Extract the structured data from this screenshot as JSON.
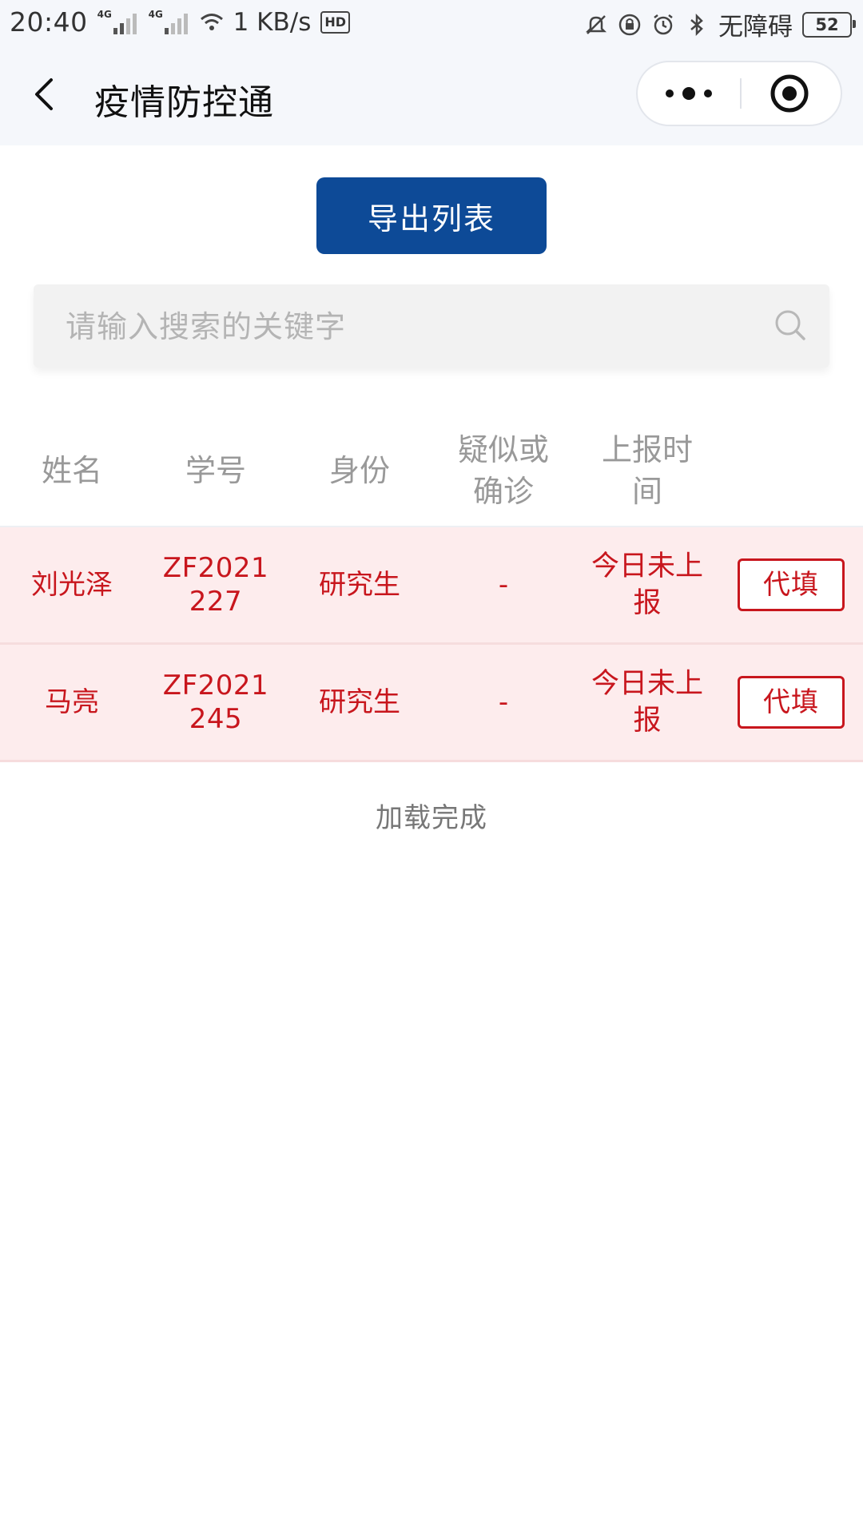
{
  "status_bar": {
    "time": "20:40",
    "network_1": "4G",
    "network_2": "4G",
    "speed": "1 KB/s",
    "hd": "HD",
    "accessibility": "无障碍",
    "battery": "52"
  },
  "nav": {
    "title": "疫情防控通"
  },
  "toolbar": {
    "export_label": "导出列表"
  },
  "search": {
    "placeholder": "请输入搜索的关键字",
    "value": ""
  },
  "table": {
    "headers": [
      "姓名",
      "学号",
      "身份",
      "疑似或确诊",
      "上报时间",
      ""
    ],
    "rows": [
      {
        "name": "刘光泽",
        "student_id": "ZF2021227",
        "role": "研究生",
        "suspected": "-",
        "report_time": "今日未上报",
        "action_label": "代填"
      },
      {
        "name": "马亮",
        "student_id": "ZF2021245",
        "role": "研究生",
        "suspected": "-",
        "report_time": "今日未上报",
        "action_label": "代填"
      }
    ]
  },
  "footer": {
    "load_status": "加载完成"
  },
  "colors": {
    "primary": "#0d4a97",
    "alert_text": "#c8161d",
    "alert_row_bg": "#fdeced",
    "header_text": "#999999",
    "nav_bg": "#f5f7fb"
  }
}
